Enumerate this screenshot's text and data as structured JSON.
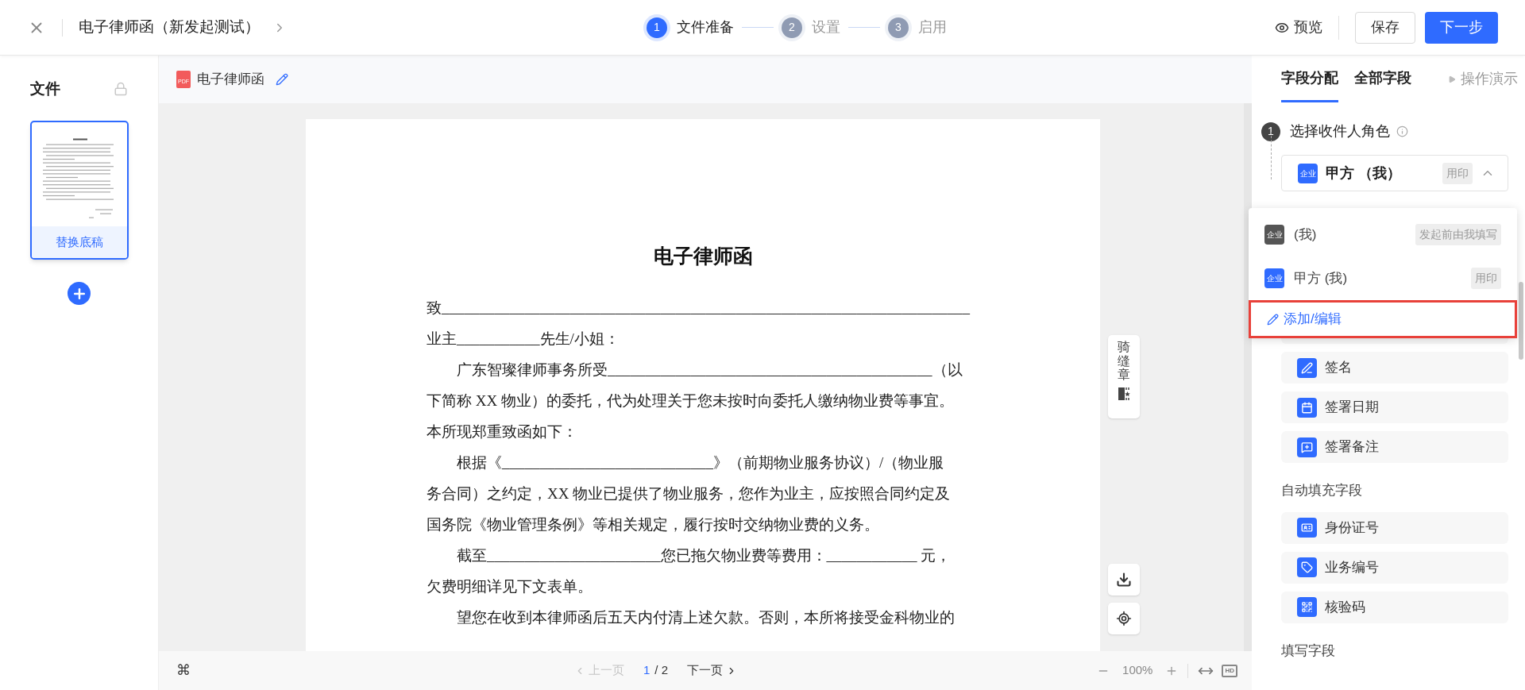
{
  "topbar": {
    "title": "电子律师函（新发起测试）",
    "steps": [
      {
        "number": "1",
        "label": "文件准备",
        "selected": true
      },
      {
        "number": "2",
        "label": "设置",
        "selected": false
      },
      {
        "number": "3",
        "label": "启用",
        "selected": false
      }
    ],
    "preview": "预览",
    "save": "保存",
    "next": "下一步"
  },
  "files_panel": {
    "title": "文件",
    "thumbnail_action": "替换底稿"
  },
  "document": {
    "file_badge": "PDF",
    "file_name": "电子律师函",
    "page_title": "电子律师函",
    "lines": [
      "致______________________________________________________________________",
      "业主___________先生/小姐：",
      "　　广东智璨律师事务所受___________________________________________（以",
      "下简称 XX 物业）的委托，代为处理关于您未按时向委托人缴纳物业费等事宜。",
      "本所现郑重致函如下：",
      "　　根据《____________________________》（前期物业服务协议）/（物业服",
      "务合同）之约定，XX 物业已提供了物业服务，您作为业主，应按照合同约定及",
      "国务院《物业管理条例》等相关规定，履行按时交纳物业费的义务。",
      "　　截至_______________________您已拖欠物业费等费用：____________ 元，",
      "欠费明细详见下文表单。",
      "　　望您在收到本律师函后五天内付清上述欠款。否则，本所将接受金科物业的"
    ],
    "seam_seal": "骑缝章"
  },
  "pager": {
    "shortcut": "⌘",
    "prev": "上一页",
    "prev_disabled": true,
    "page": "1",
    "total": "/ 2",
    "next": "下一页",
    "next_disabled": false,
    "zoom": "100%",
    "hd": "HD"
  },
  "fields_panel": {
    "tabs": [
      {
        "label": "字段分配",
        "selected": true
      },
      {
        "label": "全部字段",
        "selected": false
      }
    ],
    "demo": "操作演示",
    "step_number": "1",
    "step_label": "选择收件人角色",
    "role_select": {
      "badge": "企业",
      "name": "甲方 （我）",
      "tag": "用印",
      "expanded": true
    },
    "role_menu": [
      {
        "badge": "企业",
        "name": "(我)",
        "tag": "发起前由我填写",
        "color": "#555555"
      },
      {
        "badge": "企业",
        "name": "甲方 (我)",
        "tag": "用印",
        "color": "#2f6bff"
      }
    ],
    "menu_action": {
      "label": "添加/编辑",
      "highlighted": true
    },
    "signing_fields": [
      {
        "kind": "signature",
        "label": "签名"
      },
      {
        "kind": "date",
        "label": "签署日期"
      },
      {
        "kind": "note",
        "label": "签署备注"
      }
    ],
    "auto_section": "自动填充字段",
    "auto_fields": [
      {
        "kind": "id",
        "label": "身份证号"
      },
      {
        "kind": "number",
        "label": "业务编号"
      },
      {
        "kind": "code",
        "label": "核验码"
      }
    ],
    "fill_section": "填写字段"
  }
}
